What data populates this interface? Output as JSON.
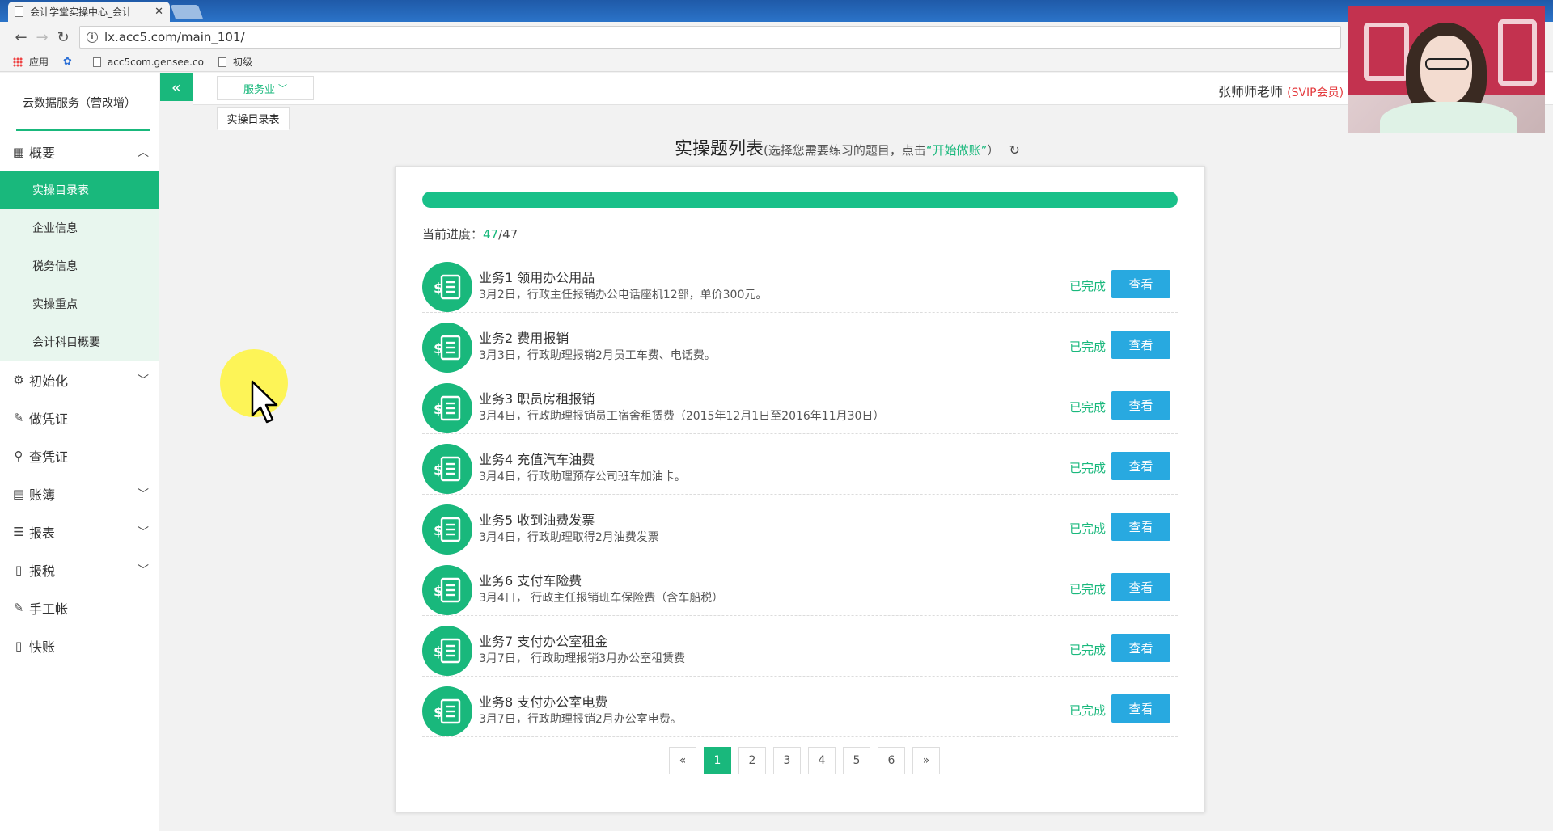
{
  "browser": {
    "tab_title": "会计学堂实操中心_会计",
    "url": "lx.acc5.com/main_101/",
    "bookmarks": [
      "应用",
      "acc5com.gensee.co",
      "初级"
    ]
  },
  "sidebar": {
    "brand": "云数据服务（营改增）",
    "groups": [
      {
        "label": "概要",
        "icon": "grid-icon",
        "expanded": true
      },
      {
        "label": "初始化",
        "icon": "gear-icon"
      },
      {
        "label": "做凭证",
        "icon": "pencil-icon"
      },
      {
        "label": "查凭证",
        "icon": "search-icon"
      },
      {
        "label": "账簿",
        "icon": "book-icon"
      },
      {
        "label": "报表",
        "icon": "list-icon"
      },
      {
        "label": "报税",
        "icon": "file-icon"
      },
      {
        "label": "手工帐",
        "icon": "pencil-icon"
      },
      {
        "label": "快账",
        "icon": "file-icon"
      }
    ],
    "sub_items": [
      "实操目录表",
      "企业信息",
      "税务信息",
      "实操重点",
      "会计科目概要"
    ]
  },
  "toolbar": {
    "collapse_icon": "«",
    "industry": "服务业",
    "user_name": "张师师老师",
    "user_badge": "(SVIP会员)"
  },
  "tabs": [
    "实操目录表"
  ],
  "heading": {
    "title": "实操题列表",
    "sub_prefix": "(选择您需要练习的题目，点击",
    "sub_highlight": "“开始做账”",
    "sub_suffix": "）"
  },
  "progress": {
    "label": "当前进度：",
    "current": "47",
    "total": "/47",
    "fraction": 1.0
  },
  "tasks": [
    {
      "title": "业务1 领用办公用品",
      "desc": "3月2日，行政主任报销办公电话座机12部，单价300元。",
      "status": "已完成",
      "action": "查看"
    },
    {
      "title": "业务2 费用报销",
      "desc": "3月3日，行政助理报销2月员工车费、电话费。",
      "status": "已完成",
      "action": "查看"
    },
    {
      "title": "业务3 职员房租报销",
      "desc": "3月4日，行政助理报销员工宿舍租赁费（2015年12月1日至2016年11月30日）",
      "status": "已完成",
      "action": "查看"
    },
    {
      "title": "业务4 充值汽车油费",
      "desc": "3月4日，行政助理预存公司班车加油卡。",
      "status": "已完成",
      "action": "查看"
    },
    {
      "title": "业务5 收到油费发票",
      "desc": "3月4日，行政助理取得2月油费发票",
      "status": "已完成",
      "action": "查看"
    },
    {
      "title": "业务6 支付车险费",
      "desc": "3月4日， 行政主任报销班车保险费（含车船税）",
      "status": "已完成",
      "action": "查看"
    },
    {
      "title": "业务7 支付办公室租金",
      "desc": "3月7日， 行政助理报销3月办公室租赁费",
      "status": "已完成",
      "action": "查看"
    },
    {
      "title": "业务8 支付办公室电费",
      "desc": "3月7日，行政助理报销2月办公室电费。",
      "status": "已完成",
      "action": "查看"
    }
  ],
  "pager": {
    "prev": "«",
    "pages": [
      "1",
      "2",
      "3",
      "4",
      "5",
      "6"
    ],
    "current": "1",
    "next": "»"
  }
}
